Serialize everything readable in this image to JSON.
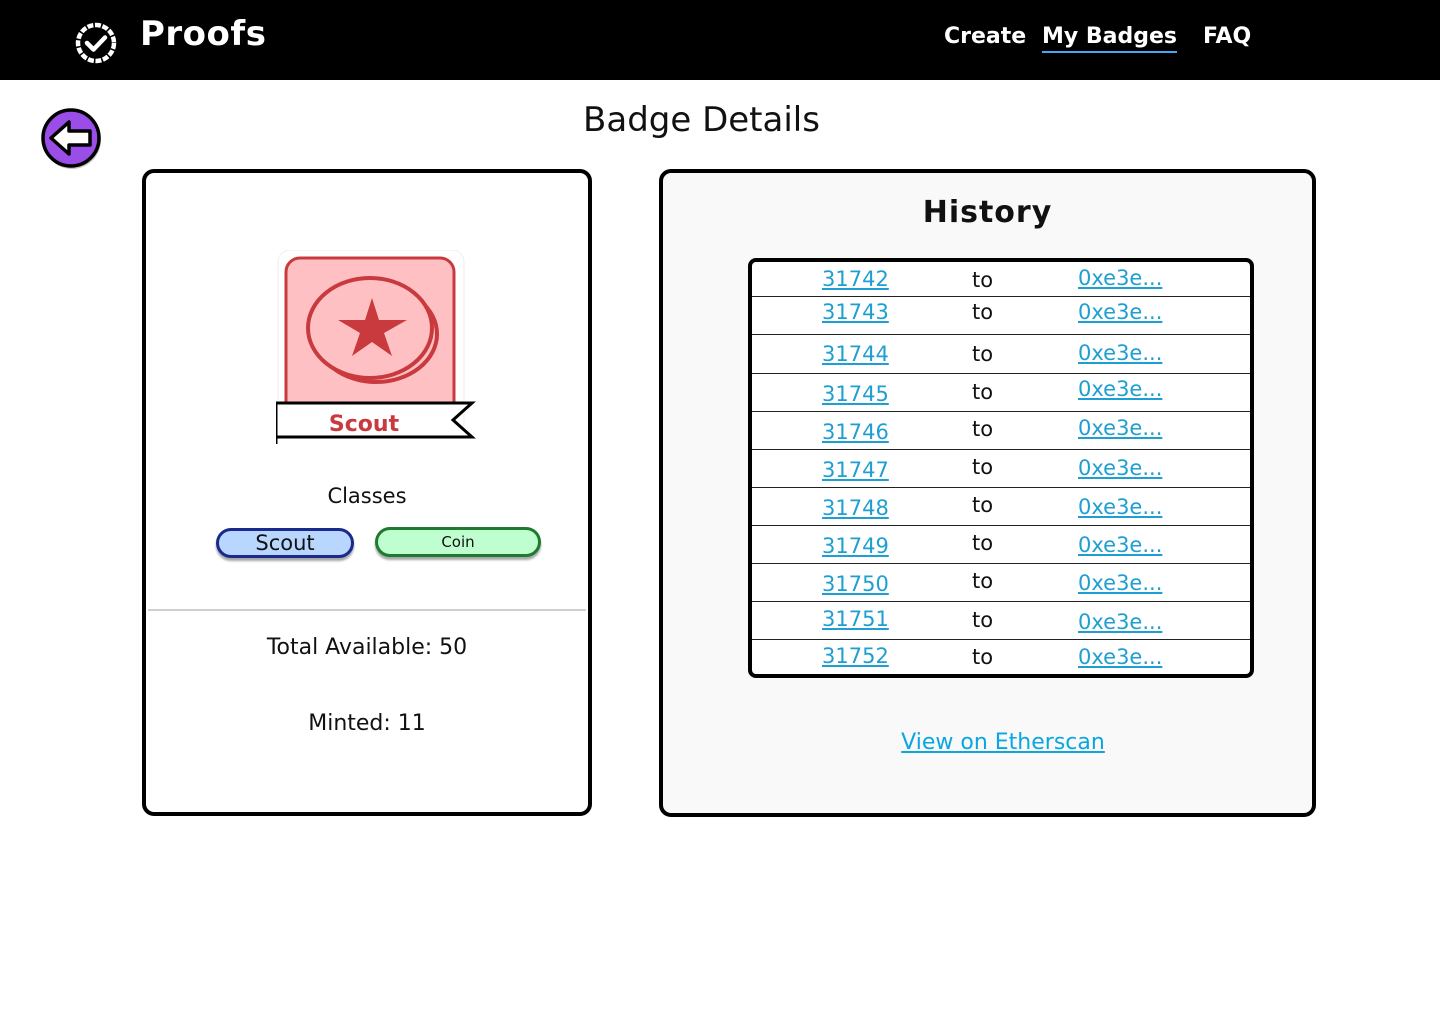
{
  "app": {
    "name": "Proofs"
  },
  "nav": {
    "create": "Create",
    "my_badges": "My Badges",
    "faq": "FAQ"
  },
  "page": {
    "title": "Badge Details"
  },
  "badge": {
    "name": "Scout",
    "classes_label": "Classes",
    "classes": [
      "Scout",
      "Coin"
    ],
    "total_available": "Total Available: 50",
    "minted": "Minted: 11"
  },
  "history": {
    "title": "History",
    "rows": [
      {
        "id": "31742",
        "to": "to",
        "address": "0xe3e..."
      },
      {
        "id": "31743",
        "to": "to",
        "address": "0xe3e..."
      },
      {
        "id": "31744",
        "to": "to",
        "address": "0xe3e..."
      },
      {
        "id": "31745",
        "to": "to",
        "address": "0xe3e..."
      },
      {
        "id": "31746",
        "to": "to",
        "address": "0xe3e..."
      },
      {
        "id": "31747",
        "to": "to",
        "address": "0xe3e..."
      },
      {
        "id": "31748",
        "to": "to",
        "address": "0xe3e..."
      },
      {
        "id": "31749",
        "to": "to",
        "address": "0xe3e..."
      },
      {
        "id": "31750",
        "to": "to",
        "address": "0xe3e..."
      },
      {
        "id": "31751",
        "to": "to",
        "address": "0xe3e..."
      },
      {
        "id": "31752",
        "to": "to",
        "address": "0xe3e..."
      }
    ],
    "etherscan_label": "View on Etherscan"
  },
  "colors": {
    "topbar": "#000000",
    "back_button": "#9b4de8",
    "badge_background": "#ffc0c4",
    "badge_accent": "#c83a3e",
    "class_scout_bg": "#b9d6ff",
    "class_coin_bg": "#bfffcf",
    "link": "#1f9fd1"
  },
  "icons": {
    "logo": "check-circle-icon",
    "back": "arrow-left-icon",
    "badge": "star-coin-icon"
  }
}
